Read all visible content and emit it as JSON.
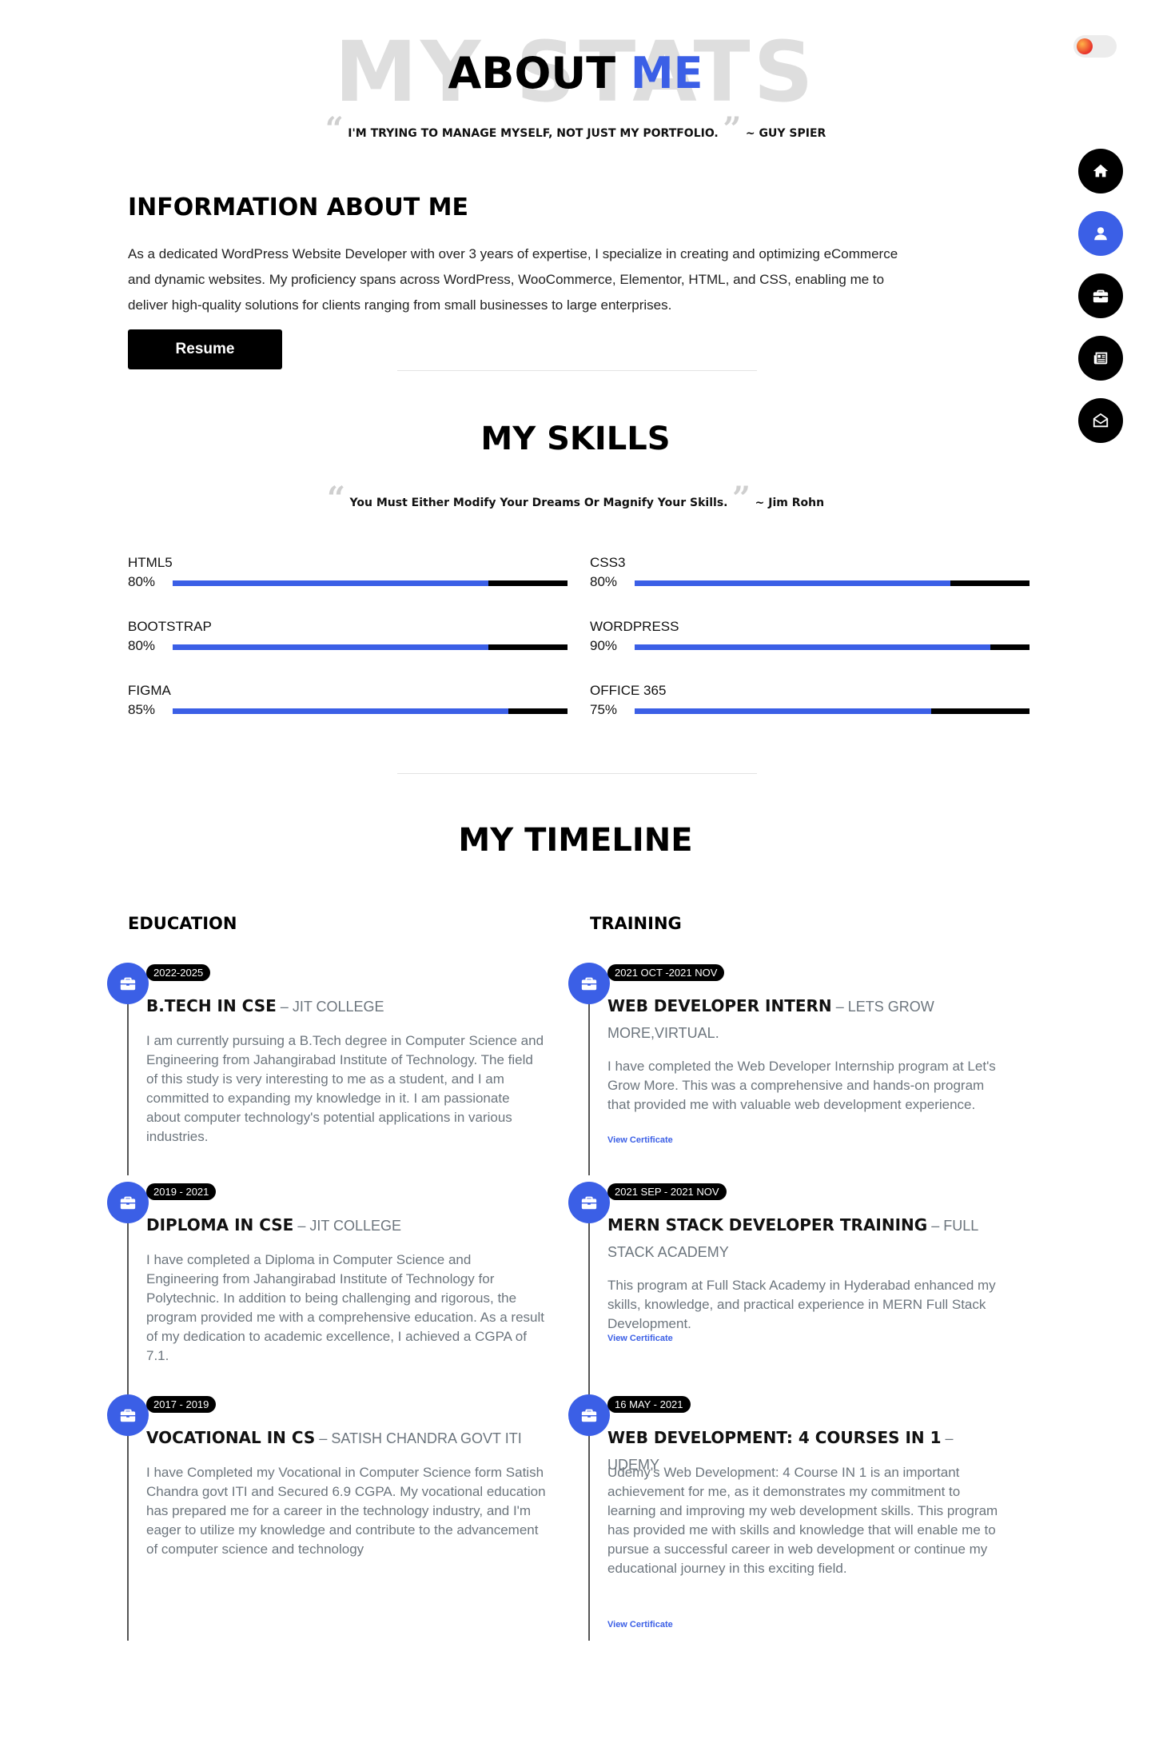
{
  "header": {
    "bg_text": "MY STATS",
    "title_main": "ABOUT",
    "title_accent": "ME",
    "quote_open": "“",
    "quote_close": "”",
    "quote_text": "I'M TRYING TO MANAGE MYSELF, NOT JUST MY PORTFOLIO.",
    "quote_author": "~ GUY SPIER"
  },
  "nav": {
    "items": [
      {
        "name": "home",
        "icon": "home-icon"
      },
      {
        "name": "about",
        "icon": "user-icon",
        "active": true
      },
      {
        "name": "portfolio",
        "icon": "briefcase-icon"
      },
      {
        "name": "blog",
        "icon": "newspaper-icon"
      },
      {
        "name": "contact",
        "icon": "envelope-open-icon"
      }
    ]
  },
  "info": {
    "title": "INFORMATION ABOUT ME",
    "text": "As a dedicated WordPress Website Developer with over 3 years of expertise, I specialize in creating and optimizing eCommerce and dynamic websites. My proficiency spans across WordPress, WooCommerce, Elementor, HTML, and CSS, enabling me to deliver high-quality solutions for clients ranging from small businesses to large enterprises.",
    "resume_label": "Resume"
  },
  "skills": {
    "title": "MY SKILLS",
    "quote_text": "You Must Either Modify Your Dreams Or Magnify Your Skills.",
    "quote_author": "~ Jim Rohn",
    "items": [
      {
        "name": "HTML5",
        "percent_label": "80%",
        "percent": 80
      },
      {
        "name": "CSS3",
        "percent_label": "80%",
        "percent": 80
      },
      {
        "name": "BOOTSTRAP",
        "percent_label": "80%",
        "percent": 80
      },
      {
        "name": "WORDPRESS",
        "percent_label": "90%",
        "percent": 90
      },
      {
        "name": "FIGMA",
        "percent_label": "85%",
        "percent": 85
      },
      {
        "name": "OFFICE 365",
        "percent_label": "75%",
        "percent": 75
      }
    ]
  },
  "timeline": {
    "title": "MY TIMELINE",
    "education": {
      "title": "EDUCATION",
      "items": [
        {
          "date": "2022-2025",
          "title": "B.TECH IN CSE",
          "org": "JIT COLLEGE",
          "desc": "I am currently pursuing a B.Tech degree in Computer Science and Engineering from Jahangirabad Institute of Technology. The field of this study is very interesting to me as a student, and I am committed to expanding my knowledge in it. I am passionate about computer technology's potential applications in various industries."
        },
        {
          "date": "2019 - 2021",
          "title": "DIPLOMA IN CSE",
          "org": "JIT COLLEGE",
          "desc": "I have completed a Diploma in Computer Science and Engineering from Jahangirabad Institute of Technology for Polytechnic. In addition to being challenging and rigorous, the program provided me with a comprehensive education. As a result of my dedication to academic excellence, I achieved a CGPA of 7.1."
        },
        {
          "date": "2017 - 2019",
          "title": "VOCATIONAL IN CS",
          "org": "SATISH CHANDRA GOVT ITI",
          "desc": "I have Completed my Vocational in Computer Science form Satish Chandra govt ITI and Secured 6.9 CGPA. My vocational education has prepared me for a career in the technology industry, and I'm eager to utilize my knowledge and contribute to the advancement of computer science and technology"
        }
      ]
    },
    "training": {
      "title": "TRAINING",
      "items": [
        {
          "date": "2021 OCT -2021 NOV",
          "title": "WEB DEVELOPER INTERN",
          "org": "LETS GROW MORE,VIRTUAL.",
          "desc": "I have completed the Web Developer Internship program at Let's Grow More. This was a comprehensive and hands-on program that provided me with valuable web development experience.",
          "link": "View Certificate"
        },
        {
          "date": "2021 SEP - 2021 NOV",
          "title": "MERN STACK DEVELOPER TRAINING",
          "org": "FULL STACK ACADEMY",
          "desc": "This program at Full Stack Academy in Hyderabad enhanced my skills, knowledge, and practical experience in MERN Full Stack Development.",
          "link": "View Certificate"
        },
        {
          "date": "16 MAY - 2021",
          "title": "WEB DEVELOPMENT: 4 COURSES IN 1",
          "org": "UDEMY",
          "desc": "Udemy's Web Development: 4 Course IN 1 is an important achievement for me, as it demonstrates my commitment to learning and improving my web development skills. This program has provided me with skills and knowledge that will enable me to pursue a successful career in web development or continue my educational journey in this exciting field.",
          "link": "View Certificate"
        }
      ]
    }
  },
  "colors": {
    "accent": "#3b5fe6",
    "dark": "#000000",
    "muted": "#6c757d"
  }
}
